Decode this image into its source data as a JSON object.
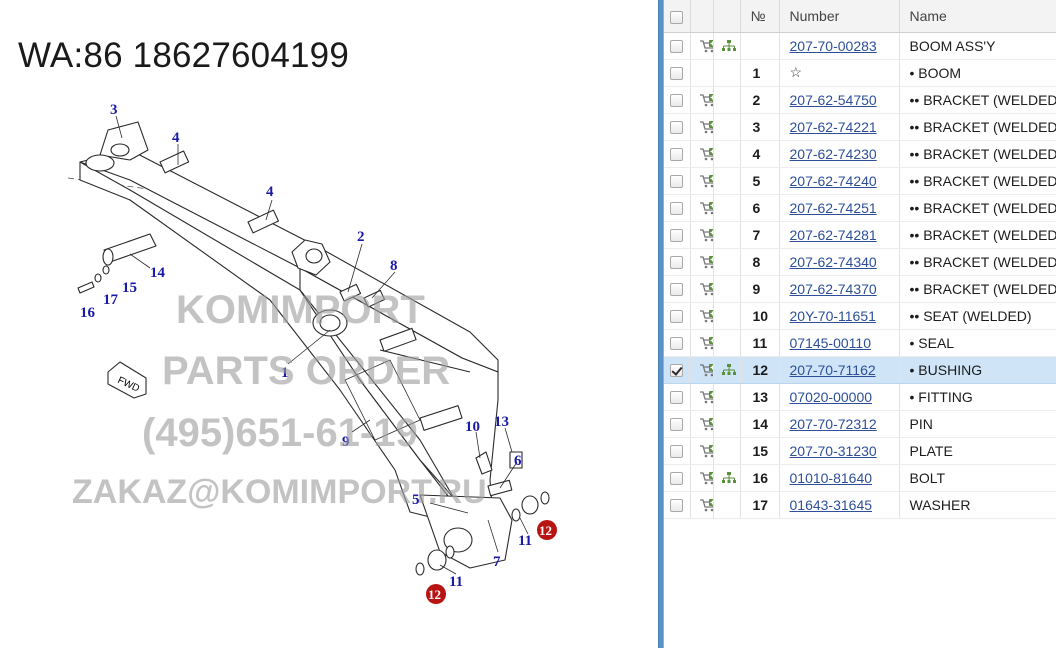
{
  "diagram": {
    "header_text": "WA:86 18627604199",
    "watermark_lines": [
      "KOMIMPORT",
      "PARTS ORDER",
      "(495)651-61-19",
      "ZAKAZ@KOMIMPORT.RU"
    ],
    "fwd_label": "FWD",
    "callouts": {
      "c1": "1",
      "c2": "2",
      "c3": "3",
      "c4a": "4",
      "c4b": "4",
      "c5": "5",
      "c6": "6",
      "c7": "7",
      "c8": "8",
      "c9": "9",
      "c10": "10",
      "c11a": "11",
      "c11b": "11",
      "c12a": "12",
      "c12b": "12",
      "c13": "13",
      "c14": "14",
      "c15": "15",
      "c16": "16",
      "c17": "17"
    },
    "highlight_color": "#b81414"
  },
  "table": {
    "headers": {
      "no": "№",
      "number": "Number",
      "name": "Name"
    },
    "rows": [
      {
        "no": "",
        "number": "207-70-00283",
        "name": "BOOM ASS'Y",
        "checked": false,
        "cart": true,
        "tree": true,
        "selected": false
      },
      {
        "no": "1",
        "number": "☆",
        "name": "• BOOM",
        "checked": false,
        "cart": false,
        "tree": false,
        "selected": false,
        "is_star": true
      },
      {
        "no": "2",
        "number": "207-62-54750",
        "name": "•• BRACKET (WELDED)",
        "checked": false,
        "cart": true,
        "tree": false,
        "selected": false
      },
      {
        "no": "3",
        "number": "207-62-74221",
        "name": "•• BRACKET (WELDED)",
        "checked": false,
        "cart": true,
        "tree": false,
        "selected": false
      },
      {
        "no": "4",
        "number": "207-62-74230",
        "name": "•• BRACKET (WELDED)",
        "checked": false,
        "cart": true,
        "tree": false,
        "selected": false
      },
      {
        "no": "5",
        "number": "207-62-74240",
        "name": "•• BRACKET (WELDED)",
        "checked": false,
        "cart": true,
        "tree": false,
        "selected": false
      },
      {
        "no": "6",
        "number": "207-62-74251",
        "name": "•• BRACKET (WELDED)",
        "checked": false,
        "cart": true,
        "tree": false,
        "selected": false
      },
      {
        "no": "7",
        "number": "207-62-74281",
        "name": "•• BRACKET (WELDED)",
        "checked": false,
        "cart": true,
        "tree": false,
        "selected": false
      },
      {
        "no": "8",
        "number": "207-62-74340",
        "name": "•• BRACKET (WELDED)",
        "checked": false,
        "cart": true,
        "tree": false,
        "selected": false
      },
      {
        "no": "9",
        "number": "207-62-74370",
        "name": "•• BRACKET (WELDED)",
        "checked": false,
        "cart": true,
        "tree": false,
        "selected": false
      },
      {
        "no": "10",
        "number": "20Y-70-11651",
        "name": "•• SEAT (WELDED)",
        "checked": false,
        "cart": true,
        "tree": false,
        "selected": false
      },
      {
        "no": "11",
        "number": "07145-00110",
        "name": "• SEAL",
        "checked": false,
        "cart": true,
        "tree": false,
        "selected": false
      },
      {
        "no": "12",
        "number": "207-70-71162",
        "name": "• BUSHING",
        "checked": true,
        "cart": true,
        "tree": true,
        "selected": true
      },
      {
        "no": "13",
        "number": "07020-00000",
        "name": "• FITTING",
        "checked": false,
        "cart": true,
        "tree": false,
        "selected": false
      },
      {
        "no": "14",
        "number": "207-70-72312",
        "name": "PIN",
        "checked": false,
        "cart": true,
        "tree": false,
        "selected": false
      },
      {
        "no": "15",
        "number": "207-70-31230",
        "name": "PLATE",
        "checked": false,
        "cart": true,
        "tree": false,
        "selected": false
      },
      {
        "no": "16",
        "number": "01010-81640",
        "name": "BOLT",
        "checked": false,
        "cart": true,
        "tree": true,
        "selected": false
      },
      {
        "no": "17",
        "number": "01643-31645",
        "name": "WASHER",
        "checked": false,
        "cart": true,
        "tree": false,
        "selected": false
      }
    ]
  },
  "colors": {
    "splitter": "#5b93c8",
    "link": "#2d4f9a",
    "selected_row": "#cfe5f7",
    "callout": "#1a1aa8",
    "cart": "#5a8f3c"
  },
  "icons": {
    "cart": "cart-icon",
    "tree": "tree-icon",
    "checkbox": "checkbox-icon"
  }
}
